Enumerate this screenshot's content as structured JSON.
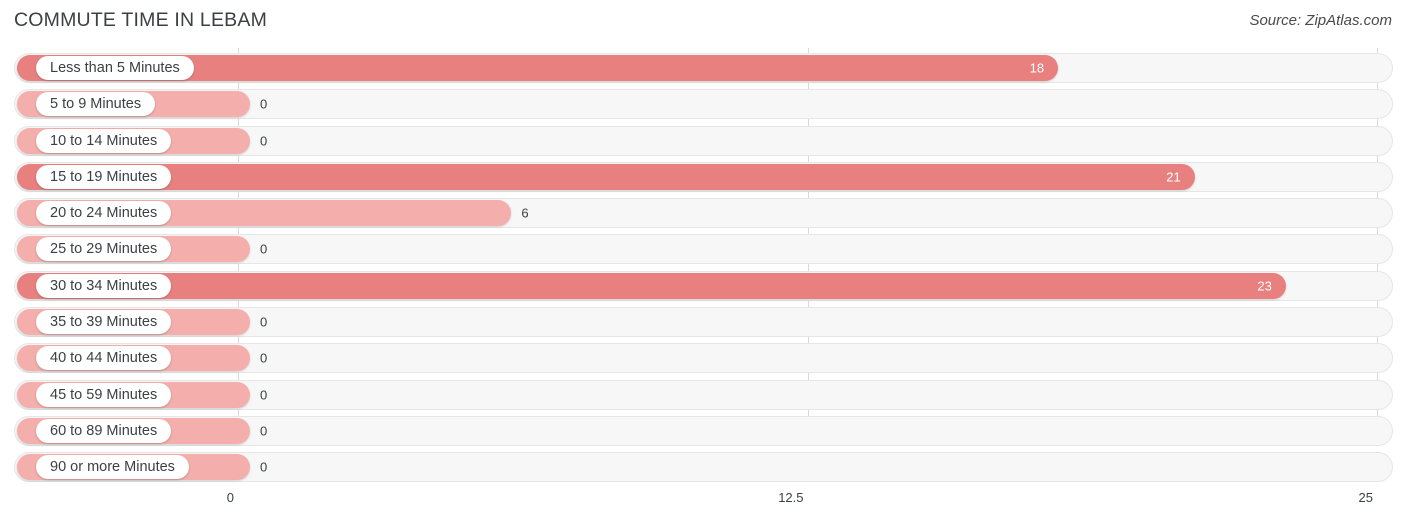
{
  "header": {
    "title": "COMMUTE TIME IN LEBAM",
    "source": "Source: ZipAtlas.com"
  },
  "colors": {
    "bar_dark": "#e8807f",
    "bar_light": "#f4afac",
    "track": "#f7f7f7",
    "gridline": "#d9d9d9",
    "text": "#3c4043"
  },
  "axis": {
    "ticks": [
      {
        "label": "0",
        "value": 0
      },
      {
        "label": "12.5",
        "value": 12.5
      },
      {
        "label": "25",
        "value": 25
      }
    ],
    "min": 0,
    "max": 25
  },
  "chart_data": {
    "type": "bar",
    "orientation": "horizontal",
    "title": "COMMUTE TIME IN LEBAM",
    "subtitle": "Source: ZipAtlas.com",
    "xlabel": "",
    "ylabel": "",
    "xlim": [
      0,
      25
    ],
    "grid": true,
    "legend": "none",
    "categories": [
      "Less than 5 Minutes",
      "5 to 9 Minutes",
      "10 to 14 Minutes",
      "15 to 19 Minutes",
      "20 to 24 Minutes",
      "25 to 29 Minutes",
      "30 to 34 Minutes",
      "35 to 39 Minutes",
      "40 to 44 Minutes",
      "45 to 59 Minutes",
      "60 to 89 Minutes",
      "90 or more Minutes"
    ],
    "values": [
      18,
      0,
      0,
      21,
      6,
      0,
      23,
      0,
      0,
      0,
      0,
      0
    ],
    "value_labels": [
      "18",
      "0",
      "0",
      "21",
      "6",
      "0",
      "23",
      "0",
      "0",
      "0",
      "0",
      "0"
    ]
  },
  "rows": [
    {
      "label": "Less than 5 Minutes",
      "value": 18,
      "value_label": "18",
      "tone": "dark",
      "inside": true
    },
    {
      "label": "5 to 9 Minutes",
      "value": 0,
      "value_label": "0",
      "tone": "light",
      "inside": false
    },
    {
      "label": "10 to 14 Minutes",
      "value": 0,
      "value_label": "0",
      "tone": "light",
      "inside": false
    },
    {
      "label": "15 to 19 Minutes",
      "value": 21,
      "value_label": "21",
      "tone": "dark",
      "inside": true
    },
    {
      "label": "20 to 24 Minutes",
      "value": 6,
      "value_label": "6",
      "tone": "light",
      "inside": false
    },
    {
      "label": "25 to 29 Minutes",
      "value": 0,
      "value_label": "0",
      "tone": "light",
      "inside": false
    },
    {
      "label": "30 to 34 Minutes",
      "value": 23,
      "value_label": "23",
      "tone": "dark",
      "inside": true
    },
    {
      "label": "35 to 39 Minutes",
      "value": 0,
      "value_label": "0",
      "tone": "light",
      "inside": false
    },
    {
      "label": "40 to 44 Minutes",
      "value": 0,
      "value_label": "0",
      "tone": "light",
      "inside": false
    },
    {
      "label": "45 to 59 Minutes",
      "value": 0,
      "value_label": "0",
      "tone": "light",
      "inside": false
    },
    {
      "label": "60 to 89 Minutes",
      "value": 0,
      "value_label": "0",
      "tone": "light",
      "inside": false
    },
    {
      "label": "90 or more Minutes",
      "value": 0,
      "value_label": "0",
      "tone": "light",
      "inside": false
    }
  ]
}
